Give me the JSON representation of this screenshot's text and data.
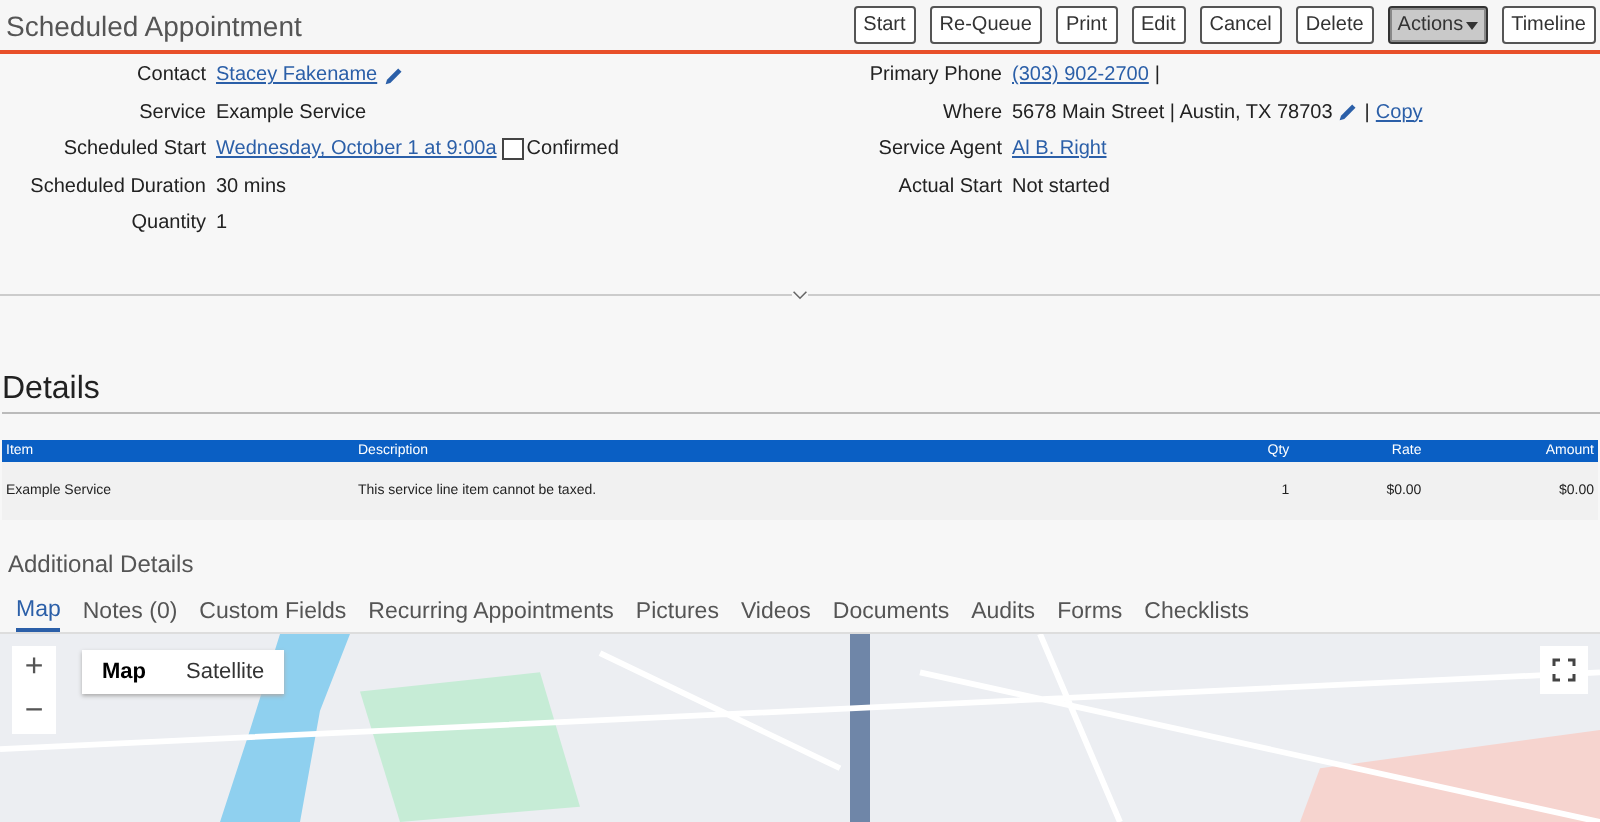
{
  "title": "Scheduled Appointment",
  "actions": [
    {
      "label": "Start",
      "kind": "button",
      "selected": false
    },
    {
      "label": "Re-Queue",
      "kind": "button",
      "selected": false
    },
    {
      "label": "Print",
      "kind": "button",
      "selected": false
    },
    {
      "label": "Edit",
      "kind": "button",
      "selected": false
    },
    {
      "label": "Cancel",
      "kind": "button",
      "selected": false
    },
    {
      "label": "Delete",
      "kind": "button",
      "selected": false
    },
    {
      "label": "Actions",
      "kind": "dropdown",
      "selected": true
    },
    {
      "label": "Timeline",
      "kind": "button",
      "selected": false
    }
  ],
  "fields_left": [
    {
      "label": "Contact",
      "parts": [
        {
          "kind": "link",
          "text": "Stacey Fakename"
        },
        {
          "kind": "edit"
        }
      ]
    },
    {
      "label": "Service",
      "parts": [
        {
          "kind": "text",
          "text": "Example Service"
        }
      ]
    },
    {
      "label": "Scheduled Start",
      "parts": [
        {
          "kind": "link",
          "text": "Wednesday, October 1 at 9:00a"
        },
        {
          "kind": "checkbox",
          "text": "Confirmed",
          "checked": false
        }
      ]
    },
    {
      "label": "Scheduled Duration",
      "parts": [
        {
          "kind": "text",
          "text": "30 mins"
        }
      ]
    },
    {
      "label": "Quantity",
      "parts": [
        {
          "kind": "text",
          "text": "1"
        }
      ]
    }
  ],
  "fields_right": [
    {
      "label": "Primary Phone",
      "parts": [
        {
          "kind": "link",
          "text": "(303) 902-2700"
        },
        {
          "kind": "text",
          "text": "|"
        }
      ]
    },
    {
      "label": "Where",
      "parts": [
        {
          "kind": "text",
          "text": "5678 Main Street | Austin, TX 78703"
        },
        {
          "kind": "edit"
        },
        {
          "kind": "text",
          "text": "|"
        },
        {
          "kind": "link",
          "text": "Copy"
        }
      ]
    },
    {
      "label": "Service Agent",
      "parts": [
        {
          "kind": "link",
          "text": "Al B. Right"
        }
      ]
    },
    {
      "label": "Actual Start",
      "parts": [
        {
          "kind": "text",
          "text": "Not started"
        }
      ]
    }
  ],
  "details": {
    "heading": "Details",
    "columns": [
      "Item",
      "Description",
      "Qty",
      "Rate",
      "Amount"
    ],
    "rows": [
      [
        "Example Service",
        "This service line item cannot be taxed.",
        "1",
        "$0.00",
        "$0.00"
      ]
    ]
  },
  "additional": {
    "heading": "Additional Details",
    "tabs": [
      {
        "label": "Map",
        "selected": true
      },
      {
        "label": "Notes (0)",
        "selected": false
      },
      {
        "label": "Custom Fields",
        "selected": false
      },
      {
        "label": "Recurring Appointments",
        "selected": false
      },
      {
        "label": "Pictures",
        "selected": false
      },
      {
        "label": "Videos",
        "selected": false
      },
      {
        "label": "Documents",
        "selected": false
      },
      {
        "label": "Audits",
        "selected": false
      },
      {
        "label": "Forms",
        "selected": false
      },
      {
        "label": "Checklists",
        "selected": false
      }
    ],
    "map": {
      "zoom_in": "+",
      "zoom_out": "−",
      "types": [
        {
          "label": "Map",
          "selected": true
        },
        {
          "label": "Satellite",
          "selected": false
        }
      ]
    }
  }
}
